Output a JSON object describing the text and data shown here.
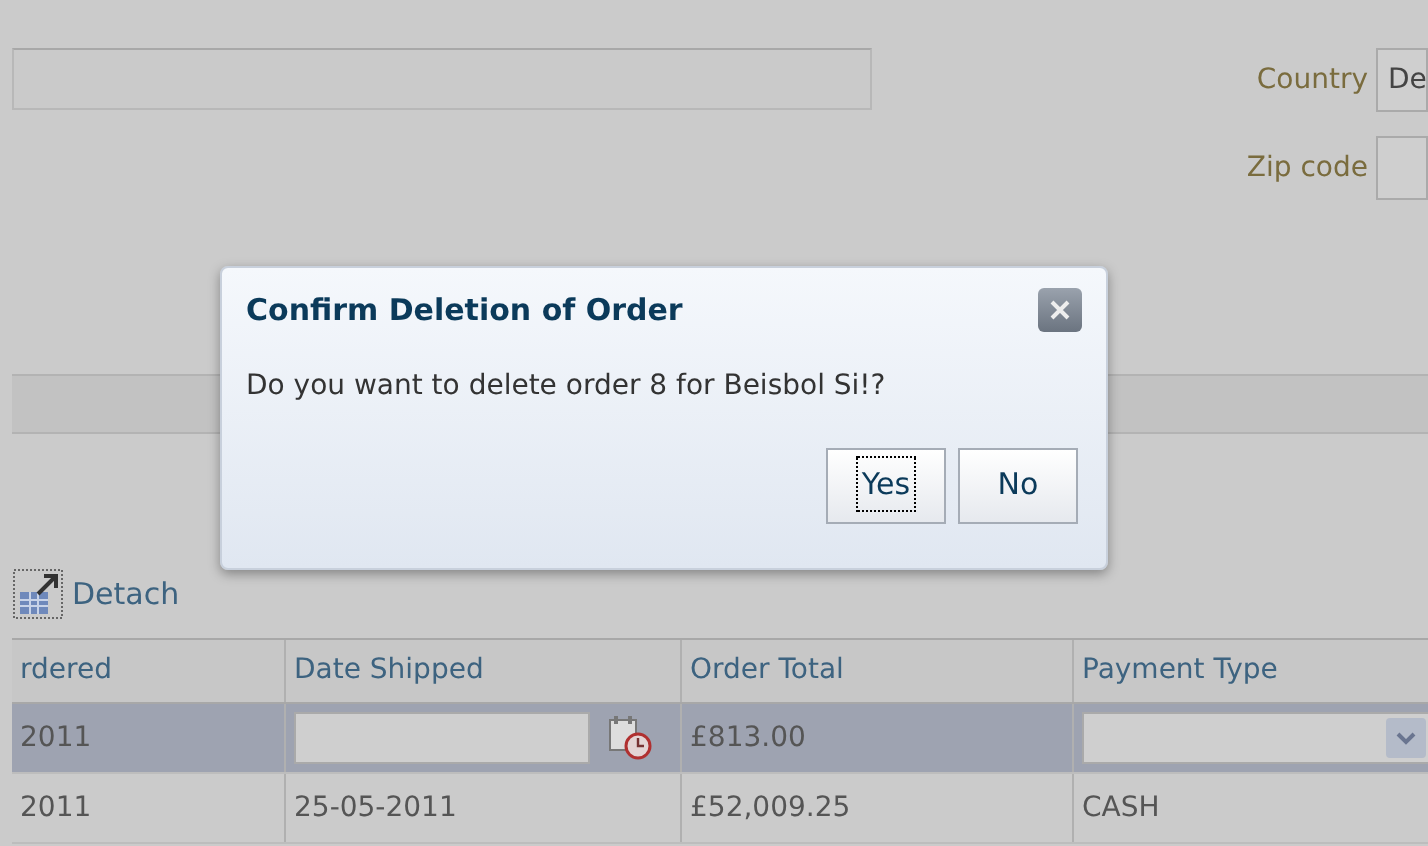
{
  "form": {
    "country": {
      "label": "Country",
      "value": "De"
    },
    "zip_code": {
      "label": "Zip code"
    }
  },
  "toolbar": {
    "detach": "Detach"
  },
  "table": {
    "columns": [
      "rdered",
      "Date Shipped",
      "Order Total",
      "Payment Type"
    ],
    "rows": [
      {
        "selected": true,
        "cells": [
          {
            "kind": "text",
            "text": "2011"
          },
          {
            "kind": "date_input"
          },
          {
            "kind": "text",
            "text": "£813.00"
          },
          {
            "kind": "select"
          }
        ]
      },
      {
        "selected": false,
        "cells": [
          {
            "kind": "text",
            "text": "2011"
          },
          {
            "kind": "text",
            "text": "25-05-2011"
          },
          {
            "kind": "text",
            "text": "£52,009.25"
          },
          {
            "kind": "text",
            "text": "CASH"
          }
        ]
      }
    ]
  },
  "dialog": {
    "title": "Confirm Deletion of Order",
    "message": "Do you want to delete order 8 for Beisbol Si!?",
    "buttons": [
      {
        "label": "Yes",
        "focused": true
      },
      {
        "label": "No",
        "focused": false
      }
    ]
  }
}
